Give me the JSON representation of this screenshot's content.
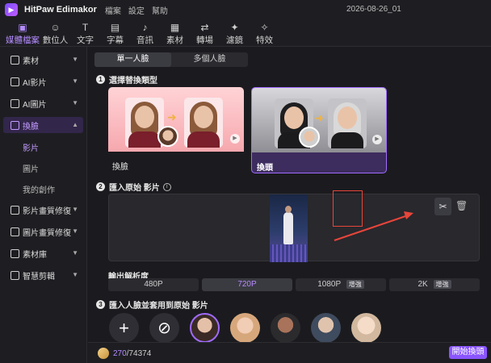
{
  "app": {
    "name": "HitPaw Edimakor",
    "project_name": "2026-08-26_01",
    "menu": [
      "檔案",
      "設定",
      "幫助"
    ]
  },
  "toolbar": {
    "items": [
      {
        "label": "媒體檔案",
        "icon": "media-icon"
      },
      {
        "label": "數位人",
        "icon": "avatar-icon"
      },
      {
        "label": "文字",
        "icon": "text-icon"
      },
      {
        "label": "字幕",
        "icon": "subtitle-icon"
      },
      {
        "label": "音訊",
        "icon": "audio-icon"
      },
      {
        "label": "素材",
        "icon": "assets-icon"
      },
      {
        "label": "轉場",
        "icon": "transition-icon"
      },
      {
        "label": "濾鏡",
        "icon": "filter-icon"
      },
      {
        "label": "特效",
        "icon": "effects-icon"
      }
    ],
    "active": "媒體檔案"
  },
  "sidebar": {
    "items": [
      {
        "label": "素材",
        "icon": "folder-icon"
      },
      {
        "label": "AI影片",
        "icon": "ai-video-icon"
      },
      {
        "label": "AI圖片",
        "icon": "ai-image-icon"
      },
      {
        "label": "換臉",
        "icon": "face-swap-icon"
      },
      {
        "label": "影片畫質修復",
        "icon": "video-enhance-icon"
      },
      {
        "label": "圖片畫質修復",
        "icon": "image-enhance-icon"
      },
      {
        "label": "素材庫",
        "icon": "library-icon"
      },
      {
        "label": "智慧剪輯",
        "icon": "smart-cut-icon"
      }
    ],
    "subitems": [
      "影片",
      "圖片",
      "我的創作"
    ]
  },
  "main": {
    "tabs": [
      "單一人臉",
      "多個人臉"
    ],
    "step1": {
      "num": "1",
      "title": "選擇替換類型"
    },
    "swap_types": [
      {
        "label": "換臉"
      },
      {
        "label": "換頭"
      }
    ],
    "step2": {
      "num": "2",
      "title": "匯入原始 影片"
    },
    "resolution": {
      "label": "輸出解析度",
      "options": [
        {
          "label": "480P",
          "badge": ""
        },
        {
          "label": "720P",
          "badge": ""
        },
        {
          "label": "1080P",
          "badge": "增強"
        },
        {
          "label": "2K",
          "badge": "增強"
        }
      ],
      "selected": "720P"
    },
    "step3": {
      "num": "3",
      "title": "匯入人臉並套用到原始 影片"
    }
  },
  "bottom": {
    "credits_used": "270",
    "credits_total": "/74374",
    "start_button": "開始換頭"
  },
  "colors": {
    "accent": "#8a55ff",
    "highlight": "#e8453a"
  }
}
